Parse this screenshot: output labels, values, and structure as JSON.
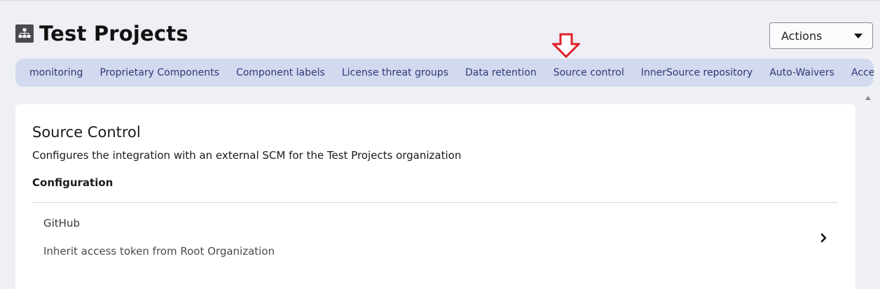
{
  "header": {
    "title": "Test Projects",
    "actions_label": "Actions"
  },
  "tabs": [
    {
      "label": "monitoring"
    },
    {
      "label": "Proprietary Components"
    },
    {
      "label": "Component labels"
    },
    {
      "label": "License threat groups"
    },
    {
      "label": "Data retention"
    },
    {
      "label": "Source control",
      "active": true
    },
    {
      "label": "InnerSource repository"
    },
    {
      "label": "Auto-Waivers"
    },
    {
      "label": "Access"
    }
  ],
  "source_control": {
    "title": "Source Control",
    "description": "Configures the integration with an external SCM for the Test Projects organization",
    "configuration_heading": "Configuration",
    "provider": "GitHub",
    "token_setting": "Inherit access token from Root Organization"
  },
  "colors": {
    "tab_bar_bg": "#d3d9ee",
    "tab_text": "#2c3a78",
    "indicator_arrow": "#e0202a"
  },
  "icons": {
    "org": "org-hierarchy-icon",
    "actions_caret": "caret-down-icon",
    "indicator": "arrow-down-outline-icon",
    "row_chevron": "chevron-right-icon",
    "scroll": "scroll-up-arrow-icon"
  }
}
